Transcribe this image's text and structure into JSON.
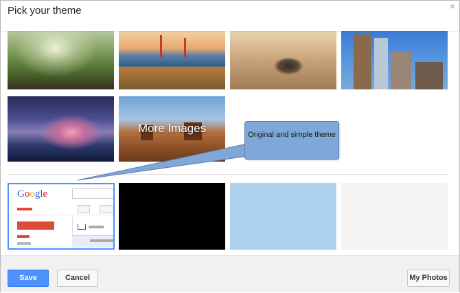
{
  "dialog": {
    "title": "Pick your theme",
    "close_icon": "close-icon",
    "close_glyph": "×"
  },
  "themes": {
    "more_images_label": "More Images",
    "simple_logo": [
      "G",
      "o",
      "o",
      "g",
      "l",
      "e"
    ],
    "simple_logo_colors": [
      "#3369e8",
      "#d50f25",
      "#eeb211",
      "#3369e8",
      "#009925",
      "#d50f25"
    ]
  },
  "callout": {
    "text": "Original and simple theme"
  },
  "footer": {
    "save_label": "Save",
    "cancel_label": "Cancel",
    "my_photos_label": "My Photos"
  },
  "colors": {
    "accent": "#4d90fe",
    "selected_border": "#4d90fe",
    "callout_fill": "#7fa7d8"
  }
}
